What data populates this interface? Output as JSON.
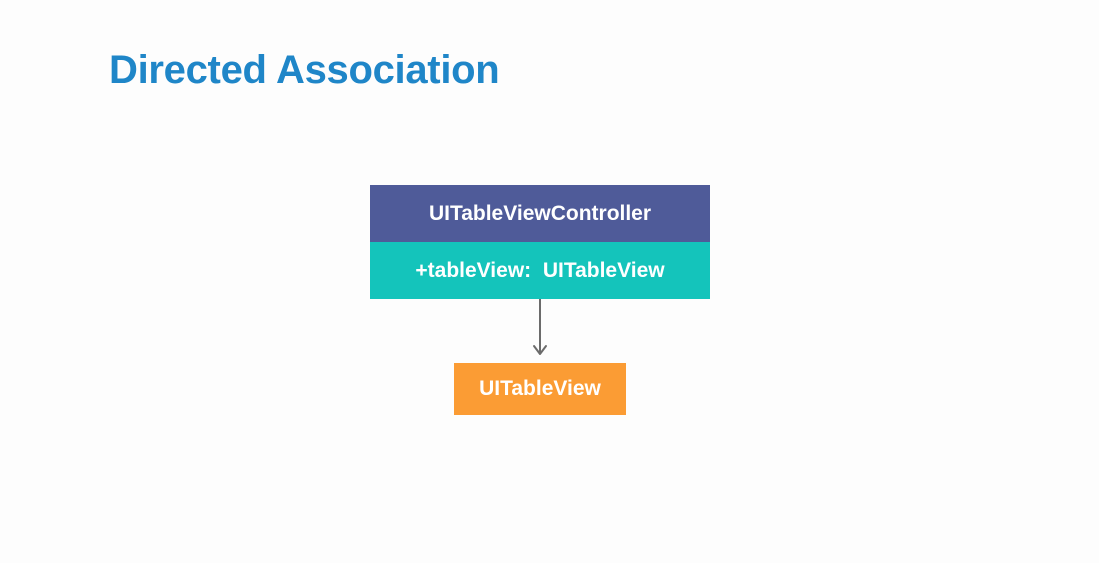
{
  "slide": {
    "title": "Directed Association"
  },
  "diagram": {
    "source_class": {
      "name": "UITableViewController",
      "attribute": "+tableView:  UITableView"
    },
    "target_class": {
      "name": "UITableView"
    },
    "relationship": {
      "type": "directed-association",
      "from": "UITableViewController",
      "to": "UITableView"
    },
    "colors": {
      "title": "#1f86c8",
      "class_header": "#4f5b99",
      "class_attribute": "#14c4bb",
      "target_class": "#fb9c34",
      "arrow": "#6b6b6b"
    }
  }
}
